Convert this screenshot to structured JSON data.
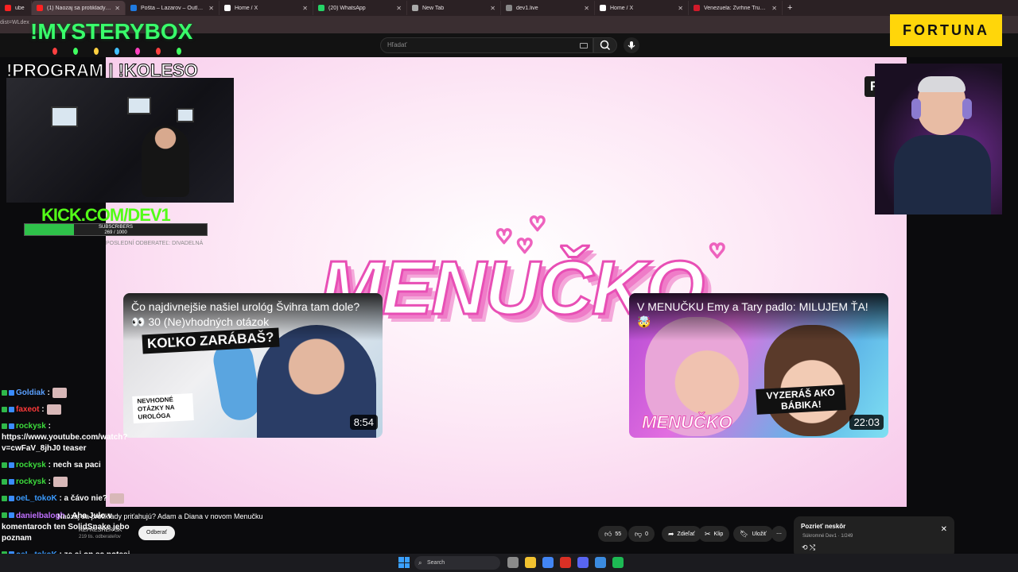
{
  "browser": {
    "tabs": [
      {
        "title": "ube",
        "fav": "#ff2222",
        "active": false
      },
      {
        "title": "(1) Naozaj sa protiklady priťahujú?",
        "fav": "#ff2222",
        "active": true
      },
      {
        "title": "Pošta – Lazarov – Outlook",
        "fav": "#1f7ae0",
        "active": false
      },
      {
        "title": "Home / X",
        "fav": "#ffffff",
        "active": false
      },
      {
        "title": "(20) WhatsApp",
        "fav": "#25d366",
        "active": false
      },
      {
        "title": "New Tab",
        "fav": "#aaaaaa",
        "active": false
      },
      {
        "title": "dev1.live",
        "fav": "#888888",
        "active": false
      },
      {
        "title": "Home / X",
        "fav": "#ffffff",
        "active": false
      },
      {
        "title": "Venezuela: Zvrhne Trump režim",
        "fav": "#d11a2a",
        "active": false
      }
    ],
    "new_tab": "+",
    "address_fragment": "dist=WLdex"
  },
  "youtube": {
    "search_placeholder": "Hľadať",
    "video_title": "Naozaj sa protiklady priťahujú? Adam a Diana v novom Menučku",
    "channel_name": "REFRESHER SK",
    "channel_subs": "219 tis. odberateľov",
    "subscribe_label": "Odberať",
    "likes": "55",
    "dislikes": "0",
    "share_label": "Zdieľať",
    "clip_label": "Klip",
    "save_label": "Uložiť",
    "more_label": "⋯"
  },
  "player": {
    "channel_logo": "R",
    "show_logo": "MENUČKO",
    "hearts": [
      "♡",
      "♡",
      "♡",
      "♡"
    ],
    "cards": [
      {
        "title": "Čo najdivnejšie našiel urológ Švihra tam dole? 👀 30 (Ne)vhodných otázok",
        "duration": "8:54",
        "sticker_1": "KOĽKO ZARÁBAŠ?",
        "sticker_2": "NEVHODNÉ OTÁZKY NA UROLÓGA"
      },
      {
        "title": "V MENUČKU Emy a Tary padlo: MILUJEM ŤA! 🤯",
        "duration": "22:03",
        "sticker_1": "VYZERÁŠ AKO BÁBIKA!",
        "brand": "MENUČKO"
      }
    ]
  },
  "overlay": {
    "mysterybox": "!MYSTERYBOX",
    "program": "!PROGRAM | !KOLESO",
    "kick": "KICK.COM/DEV1",
    "subscribers_label": "SUBSCRIBERS",
    "subscribers_count": "269 / 1000",
    "subscribers_progress": 0.269,
    "faint_text": "POSLEDNÍ ODBERATEĽ: DIVADELNÁ",
    "sponsor": "FORTUNA"
  },
  "chat": [
    {
      "user": "Goldiak",
      "color": "#5aa0ff",
      "text": ":",
      "emote": true
    },
    {
      "user": "faxeot",
      "color": "#ff3a3a",
      "text": ":",
      "emote": true
    },
    {
      "user": "rockysk",
      "color": "#3cdc3c",
      "text": ": https://www.youtube.com/watch?v=cwFaV_8jhJ0 teaser",
      "emote": false
    },
    {
      "user": "rockysk",
      "color": "#3cdc3c",
      "text": ": nech sa paci",
      "emote": false
    },
    {
      "user": "rockysk",
      "color": "#3cdc3c",
      "text": ":",
      "emote": true
    },
    {
      "user": "oeL_tokoK",
      "color": "#3a9bff",
      "text": ": a čávo nie?",
      "emote": true
    },
    {
      "user": "danielbalogh",
      "color": "#c070ff",
      "text": ": Aha Julo v komentaroch ten SolidSnake jebo poznam",
      "emote": false
    },
    {
      "user": "oeL_tokoK",
      "color": "#3a9bff",
      "text": ": ze aj on sa potesi (vlasovym doplnkom)",
      "emote": true
    }
  ],
  "popup": {
    "title": "Pozrieť neskôr",
    "subtitle": "Súkromné  Dev1 · 1/249",
    "close": "✕",
    "controls": "⟲  ⤭"
  },
  "taskbar": {
    "search_label": "Search",
    "apps": [
      "#8a8a8a",
      "#f2c230",
      "#4285f4",
      "#d93025",
      "#5865f2",
      "#3b8be0",
      "#1db954"
    ]
  }
}
